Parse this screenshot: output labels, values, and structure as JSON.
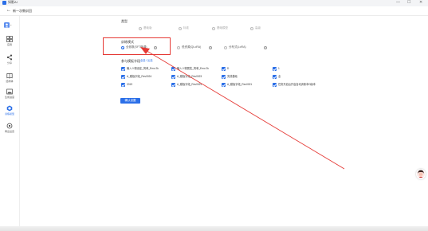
{
  "window": {
    "app_name": "如影AI",
    "minimize": "—",
    "maximize": "☐",
    "close": "✕"
  },
  "header": {
    "back_icon": "arrow-left",
    "title": "新一次教训回"
  },
  "sidebar": {
    "items": [
      {
        "label": "应用",
        "icon": "grid-icon"
      },
      {
        "label": "分享",
        "icon": "share-icon"
      },
      {
        "label": "结构体",
        "icon": "book-icon"
      },
      {
        "label": "生成进度",
        "icon": "image-icon"
      },
      {
        "label": "训练模型",
        "icon": "model-icon",
        "active": true
      },
      {
        "label": "再出设置",
        "icon": "settings-icon"
      }
    ]
  },
  "form": {
    "section_type_label": "类型",
    "type_options": [
      {
        "label": "基础版",
        "checked": false,
        "muted": true
      },
      {
        "label": "标准",
        "checked": false,
        "muted": true
      },
      {
        "label": "基础模型",
        "checked": false,
        "muted": true
      },
      {
        "label": "高级",
        "checked": false,
        "muted": true
      }
    ],
    "section_model_label": "训练模式",
    "model_options": [
      {
        "label": "全参数(SFT微调)",
        "checked": true
      },
      {
        "label": "低资源(QLoRA)",
        "checked": false
      },
      {
        "label": "分布式(LoRA)",
        "checked": false
      }
    ],
    "section_params_label": "参与模板字段",
    "params_links": "全选 / 反选",
    "params": [
      {
        "label": "输入人物设定_简单_Emo 2k",
        "checked": true
      },
      {
        "label": "输入人物属性_简单_Emo 2k",
        "checked": true
      },
      {
        "label": "D",
        "checked": true
      },
      {
        "label": "1",
        "checked": true
      },
      {
        "label": "A_模板字段_Rev0024",
        "checked": true
      },
      {
        "label": "A_模板字段_Rev0023",
        "checked": true
      },
      {
        "label": "完成基础",
        "checked": true
      },
      {
        "label": "全",
        "checked": true
      },
      {
        "label": "2019",
        "checked": true
      },
      {
        "label": "A_模板字段_Rev0023",
        "checked": true
      },
      {
        "label": "A_模板字段_Rev0021",
        "checked": true
      },
      {
        "label": "任务开启后开启自动训练本D版本",
        "checked": true
      }
    ],
    "submit_label": "确认设置"
  },
  "colors": {
    "accent": "#2b6fe8",
    "annotation": "#e53935"
  }
}
